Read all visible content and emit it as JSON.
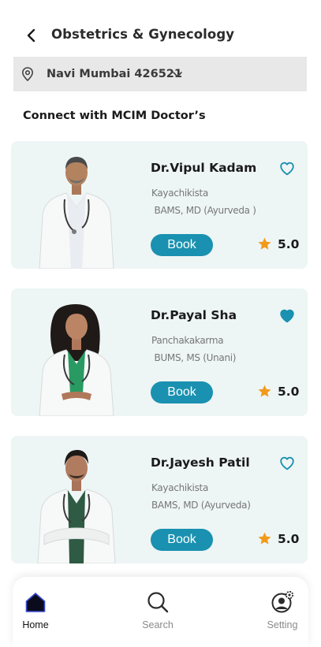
{
  "header": {
    "title": "Obstetrics & Gynecology",
    "back_icon": "chevron-left-icon"
  },
  "location": {
    "value": "Navi Mumbai 426521",
    "icon": "map-pin-icon",
    "dropdown_icon": "chevron-down-icon"
  },
  "section_title": "Connect with MCIM Doctor’s",
  "doctors": [
    {
      "name": "Dr.Vipul Kadam",
      "specialty": "Kayachikista",
      "degree": " BAMS, MD (Ayurveda )",
      "favorited": false,
      "book_label": "Book",
      "rating": "5.0"
    },
    {
      "name": "Dr.Payal Sha",
      "specialty": "Panchakakarma",
      "degree": " BUMS, MS (Unani)",
      "favorited": true,
      "book_label": "Book",
      "rating": "5.0"
    },
    {
      "name": "Dr.Jayesh Patil",
      "specialty": "Kayachikista",
      "degree": "BAMS, MD (Ayurveda)",
      "favorited": false,
      "book_label": "Book",
      "rating": "5.0"
    }
  ],
  "nav": {
    "items": [
      {
        "label": "Home",
        "icon": "home-icon",
        "active": true
      },
      {
        "label": "Search",
        "icon": "search-icon",
        "active": false
      },
      {
        "label": "Setting",
        "icon": "settings-icon",
        "active": false
      }
    ]
  },
  "colors": {
    "accent": "#1a91b0",
    "favorite": "#1a91b0",
    "star": "#f29a1a",
    "card_background": "#eef5f5",
    "location_background": "#e8e8e8",
    "nav_active": "#111111",
    "nav_inactive": "#8a8a8a"
  }
}
